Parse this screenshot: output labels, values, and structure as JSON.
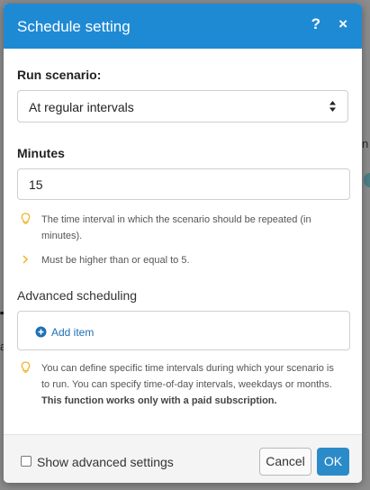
{
  "dialog": {
    "title": "Schedule setting",
    "help_icon": "question-mark-icon",
    "help_glyph": "?",
    "close_icon": "close-icon",
    "close_glyph": "×"
  },
  "run_scenario": {
    "label": "Run scenario:",
    "selected": "At regular intervals"
  },
  "minutes": {
    "label": "Minutes",
    "value": "15"
  },
  "hints": {
    "interval": "The time interval in which the scenario should be repeated (in minutes).",
    "minimum": "Must be higher than or equal to 5.",
    "advanced_plain": "You can define specific time intervals during which your scenario is to run. You can specify time-of-day intervals, weekdays or months.",
    "advanced_bold": "This function works only with a paid subscription."
  },
  "advanced_scheduling": {
    "label": "Advanced scheduling",
    "add_item": "Add item"
  },
  "footer": {
    "show_advanced": "Show advanced settings",
    "show_advanced_checked": false,
    "cancel": "Cancel",
    "ok": "OK"
  },
  "colors": {
    "header": "#1f8ad4",
    "link": "#1f6fb5",
    "ok_button": "#2b8bc8",
    "hint_icon": "#f0b429"
  }
}
